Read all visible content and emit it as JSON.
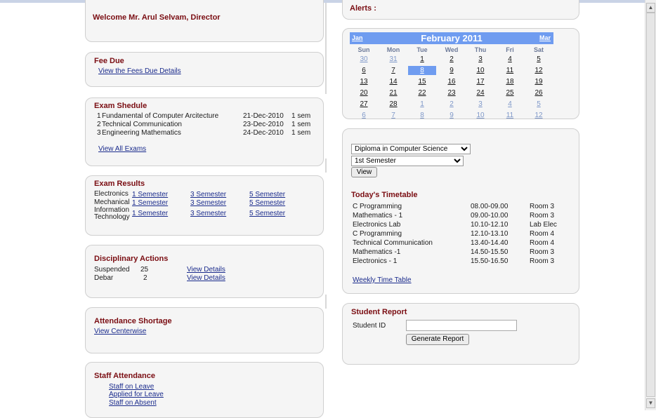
{
  "welcome": "Welcome Mr. Arul Selvam, Director",
  "fee": {
    "title": "Fee Due",
    "link": "View the Fees Due Details"
  },
  "exam_schedule": {
    "title": "Exam Shedule",
    "rows": [
      {
        "num": "1",
        "subject": "Fundamental of Computer Arcitecture",
        "date": "21-Dec-2010",
        "sem": "1 sem"
      },
      {
        "num": "2",
        "subject": "Technical Communication",
        "date": "23-Dec-2010",
        "sem": "1 sem"
      },
      {
        "num": "3",
        "subject": "Engineering Mathematics",
        "date": "24-Dec-2010",
        "sem": "1 sem"
      }
    ],
    "link": "View All Exams"
  },
  "exam_results": {
    "title": "Exam Results",
    "rows": [
      {
        "dept": "Electronics",
        "s1": "1 Semester",
        "s3": "3 Semester",
        "s5": "5 Semester"
      },
      {
        "dept": "Mechanical",
        "s1": "1 Semester",
        "s3": "3 Semester",
        "s5": "5 Semester"
      },
      {
        "dept1": "Information",
        "dept2": "Technology",
        "s1": "1 Semester",
        "s3": "3 Semester",
        "s5": "5 Semester"
      }
    ]
  },
  "disciplinary": {
    "title": "Disciplinary Actions",
    "rows": [
      {
        "type": "Suspended",
        "count": "25",
        "link": "View Details"
      },
      {
        "type": "Debar",
        "count": "2",
        "link": "View Details"
      }
    ]
  },
  "attendance_shortage": {
    "title": "Attendance Shortage",
    "link": "View Centerwise"
  },
  "staff_attendance": {
    "title": "Staff Attendance",
    "links": [
      "Staff on Leave",
      "Applied for Leave",
      "Staff on Absent"
    ]
  },
  "alerts": {
    "title": "Alerts :"
  },
  "calendar": {
    "month": "February 2011",
    "prev": "Jan",
    "next": "Mar",
    "days_of_week": [
      "Sun",
      "Mon",
      "Tue",
      "Wed",
      "Thu",
      "Fri",
      "Sat"
    ],
    "weeks": [
      [
        "30",
        "31",
        "1",
        "2",
        "3",
        "4",
        "5"
      ],
      [
        "6",
        "7",
        "8",
        "9",
        "10",
        "11",
        "12"
      ],
      [
        "13",
        "14",
        "15",
        "16",
        "17",
        "18",
        "19"
      ],
      [
        "20",
        "21",
        "22",
        "23",
        "24",
        "25",
        "26"
      ],
      [
        "27",
        "28",
        "1",
        "2",
        "3",
        "4",
        "5"
      ],
      [
        "6",
        "7",
        "8",
        "9",
        "10",
        "11",
        "12"
      ]
    ],
    "selected": "8",
    "accent": "#6f9cf0"
  },
  "timetable": {
    "course_selected": "Diploma in Computer Science",
    "semester_selected": "1st Semester",
    "view_button": "View",
    "title": "Today's Timetable",
    "rows": [
      {
        "subject": "C Programming",
        "time": "08.00-09.00",
        "room": "Room 3"
      },
      {
        "subject": "Mathematics - 1",
        "time": "09.00-10.00",
        "room": "Room 3"
      },
      {
        "subject": "Electronics Lab",
        "time": "10.10-12.10",
        "room": "Lab Elec"
      },
      {
        "subject": "C Programming",
        "time": "12.10-13.10",
        "room": "Room 4"
      },
      {
        "subject": "Technical Communication",
        "time": "13.40-14.40",
        "room": "Room 4"
      },
      {
        "subject": "Mathematics -1",
        "time": "14.50-15.50",
        "room": "Room 3"
      },
      {
        "subject": "Electronics - 1",
        "time": "15.50-16.50",
        "room": "Room 3"
      }
    ],
    "weekly_link": "Weekly Time Table"
  },
  "student_report": {
    "title": "Student Report",
    "label": "Student ID",
    "input_value": "",
    "button": "Generate Report"
  },
  "colors": {
    "heading": "#7a0d12",
    "link": "#1a2b8c",
    "panel_bg": "#f5f5f5"
  }
}
